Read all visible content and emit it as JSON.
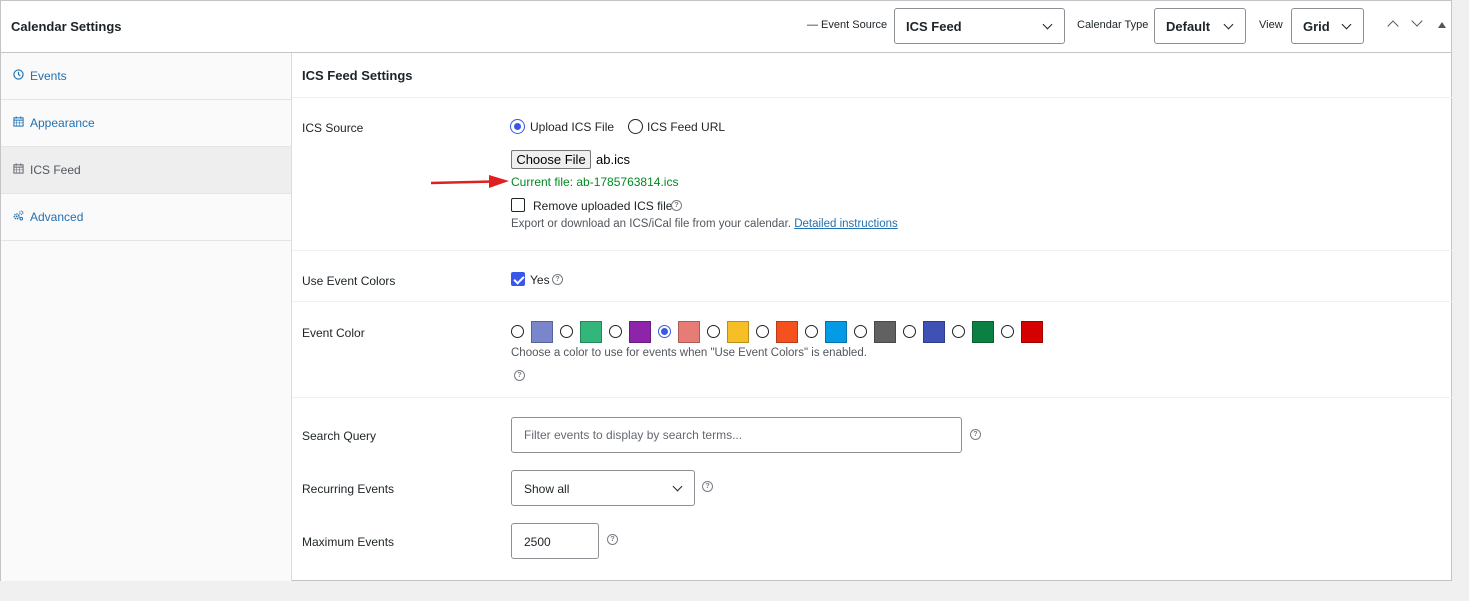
{
  "header": {
    "title": "Calendar Settings",
    "event_source_label": "— Event Source",
    "event_source_value": "ICS Feed",
    "calendar_type_label": "Calendar Type",
    "calendar_type_value": "Default",
    "view_label": "View",
    "view_value": "Grid"
  },
  "sidebar": {
    "tabs": [
      {
        "label": "Events",
        "icon": "clock-icon",
        "active": false
      },
      {
        "label": "Appearance",
        "icon": "calendar-icon",
        "active": false
      },
      {
        "label": "ICS Feed",
        "icon": "calendar-icon",
        "active": true
      },
      {
        "label": "Advanced",
        "icon": "gears-icon",
        "active": false
      }
    ]
  },
  "main": {
    "section_title": "ICS Feed Settings",
    "ics_source": {
      "label": "ICS Source",
      "option_upload": "Upload ICS File",
      "option_url": "ICS Feed URL",
      "selected": "Upload ICS File"
    },
    "file": {
      "button_label": "Choose File",
      "chosen_name": "ab.ics",
      "current_file": "Current file: ab-1785763814.ics",
      "remove_label": "Remove uploaded ICS file",
      "help_text": "Export or download an ICS/iCal file from your calendar.",
      "help_link": "Detailed instructions"
    },
    "use_event_colors": {
      "label": "Use Event Colors",
      "checkbox_label": "Yes",
      "checked": true
    },
    "event_color": {
      "label": "Event Color",
      "swatches": [
        "#7986cb",
        "#33b679",
        "#8e24aa",
        "#e67c73",
        "#f6bf26",
        "#f4511e",
        "#039be5",
        "#616161",
        "#3f51b5",
        "#0b8043",
        "#d50000"
      ],
      "selected_index": 3,
      "description": "Choose a color to use for events when \"Use Event Colors\" is enabled."
    },
    "search_query": {
      "label": "Search Query",
      "placeholder": "Filter events to display by search terms...",
      "value": ""
    },
    "recurring_events": {
      "label": "Recurring Events",
      "value": "Show all"
    },
    "maximum_events": {
      "label": "Maximum Events",
      "value": "2500"
    }
  },
  "colors": {
    "accent": "#3858e9",
    "link": "#2271b1",
    "success_text": "#008a20",
    "annotation_arrow": "#e02020"
  }
}
